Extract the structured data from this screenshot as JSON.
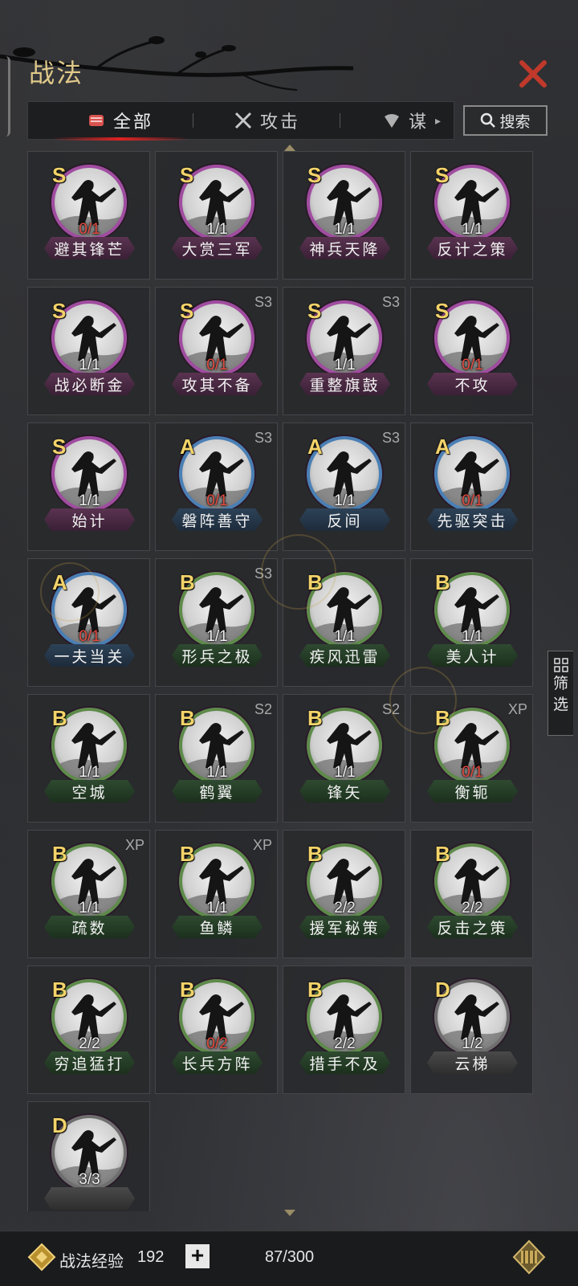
{
  "header": {
    "title": "战法"
  },
  "tabs": [
    {
      "label": "全部",
      "active": true,
      "icon": "scroll-icon"
    },
    {
      "label": "攻击",
      "active": false,
      "icon": "crossed-swords-icon"
    },
    {
      "label": "谋",
      "active": false,
      "icon": "hand-fan-icon"
    }
  ],
  "search": {
    "label": "搜索"
  },
  "filter": {
    "label_1": "筛",
    "label_2": "选"
  },
  "cards": [
    {
      "grade": "S",
      "count": "0/1",
      "name": "避其锋芒",
      "tag": ""
    },
    {
      "grade": "S",
      "count": "1/1",
      "name": "大赏三军",
      "tag": ""
    },
    {
      "grade": "S",
      "count": "1/1",
      "name": "神兵天降",
      "tag": ""
    },
    {
      "grade": "S",
      "count": "1/1",
      "name": "反计之策",
      "tag": ""
    },
    {
      "grade": "S",
      "count": "1/1",
      "name": "战必断金",
      "tag": ""
    },
    {
      "grade": "S",
      "count": "0/1",
      "name": "攻其不备",
      "tag": "S3"
    },
    {
      "grade": "S",
      "count": "1/1",
      "name": "重整旗鼓",
      "tag": "S3"
    },
    {
      "grade": "S",
      "count": "0/1",
      "name": "不攻",
      "tag": ""
    },
    {
      "grade": "S",
      "count": "1/1",
      "name": "始计",
      "tag": ""
    },
    {
      "grade": "A",
      "count": "0/1",
      "name": "磐阵善守",
      "tag": "S3"
    },
    {
      "grade": "A",
      "count": "1/1",
      "name": "反间",
      "tag": "S3"
    },
    {
      "grade": "A",
      "count": "0/1",
      "name": "先驱突击",
      "tag": ""
    },
    {
      "grade": "A",
      "count": "0/1",
      "name": "一夫当关",
      "tag": ""
    },
    {
      "grade": "B",
      "count": "1/1",
      "name": "形兵之极",
      "tag": "S3"
    },
    {
      "grade": "B",
      "count": "1/1",
      "name": "疾风迅雷",
      "tag": ""
    },
    {
      "grade": "B",
      "count": "1/1",
      "name": "美人计",
      "tag": ""
    },
    {
      "grade": "B",
      "count": "1/1",
      "name": "空城",
      "tag": ""
    },
    {
      "grade": "B",
      "count": "1/1",
      "name": "鹤翼",
      "tag": "S2"
    },
    {
      "grade": "B",
      "count": "1/1",
      "name": "锋矢",
      "tag": "S2"
    },
    {
      "grade": "B",
      "count": "0/1",
      "name": "衡轭",
      "tag": "XP"
    },
    {
      "grade": "B",
      "count": "1/1",
      "name": "疏数",
      "tag": "XP"
    },
    {
      "grade": "B",
      "count": "1/1",
      "name": "鱼鳞",
      "tag": "XP"
    },
    {
      "grade": "B",
      "count": "2/2",
      "name": "援军秘策",
      "tag": ""
    },
    {
      "grade": "B",
      "count": "2/2",
      "name": "反击之策",
      "tag": ""
    },
    {
      "grade": "B",
      "count": "2/2",
      "name": "穷追猛打",
      "tag": ""
    },
    {
      "grade": "B",
      "count": "0/2",
      "name": "长兵方阵",
      "tag": ""
    },
    {
      "grade": "B",
      "count": "2/2",
      "name": "措手不及",
      "tag": ""
    },
    {
      "grade": "D",
      "count": "1/2",
      "name": "云梯",
      "tag": ""
    },
    {
      "grade": "D",
      "count": "3/3",
      "name": "",
      "tag": ""
    }
  ],
  "footer": {
    "xp_label": "战法经验",
    "xp_value": "192",
    "add_label": "+",
    "capacity": "87/300"
  },
  "colors": {
    "gold": "#e0c98a",
    "grade_S": "#a04ca0",
    "grade_A": "#4a7fb5",
    "grade_B": "#5e8a4a",
    "grade_D": "#6e6e6e",
    "count_zero": "#e34b3f",
    "close_red": "#c0392b"
  }
}
